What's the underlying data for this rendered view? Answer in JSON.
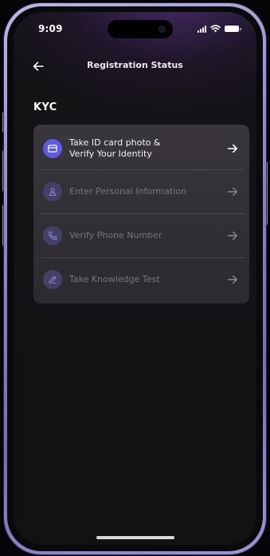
{
  "status_bar": {
    "time": "9:09"
  },
  "header": {
    "title": "Registration Status",
    "back_icon": "arrow-left-icon"
  },
  "section": {
    "title": "KYC"
  },
  "kyc_steps": [
    {
      "label_line1": "Take ID card photo &",
      "label_line2": "Verify Your Identity",
      "icon": "id-card-icon",
      "state": "active"
    },
    {
      "label_line1": "Enter Personal Information",
      "label_line2": "",
      "icon": "person-icon",
      "state": "disabled"
    },
    {
      "label_line1": "Verify Phone Number",
      "label_line2": "",
      "icon": "phone-icon",
      "state": "disabled"
    },
    {
      "label_line1": "Take Knowledge Test",
      "label_line2": "",
      "icon": "pencil-icon",
      "state": "disabled"
    }
  ],
  "colors": {
    "accent": "#5f5ae6",
    "icon_disabled_bg": "#434168",
    "card_bg": "#39363c",
    "text_primary": "#f3f3f5",
    "text_disabled": "#77757b"
  }
}
